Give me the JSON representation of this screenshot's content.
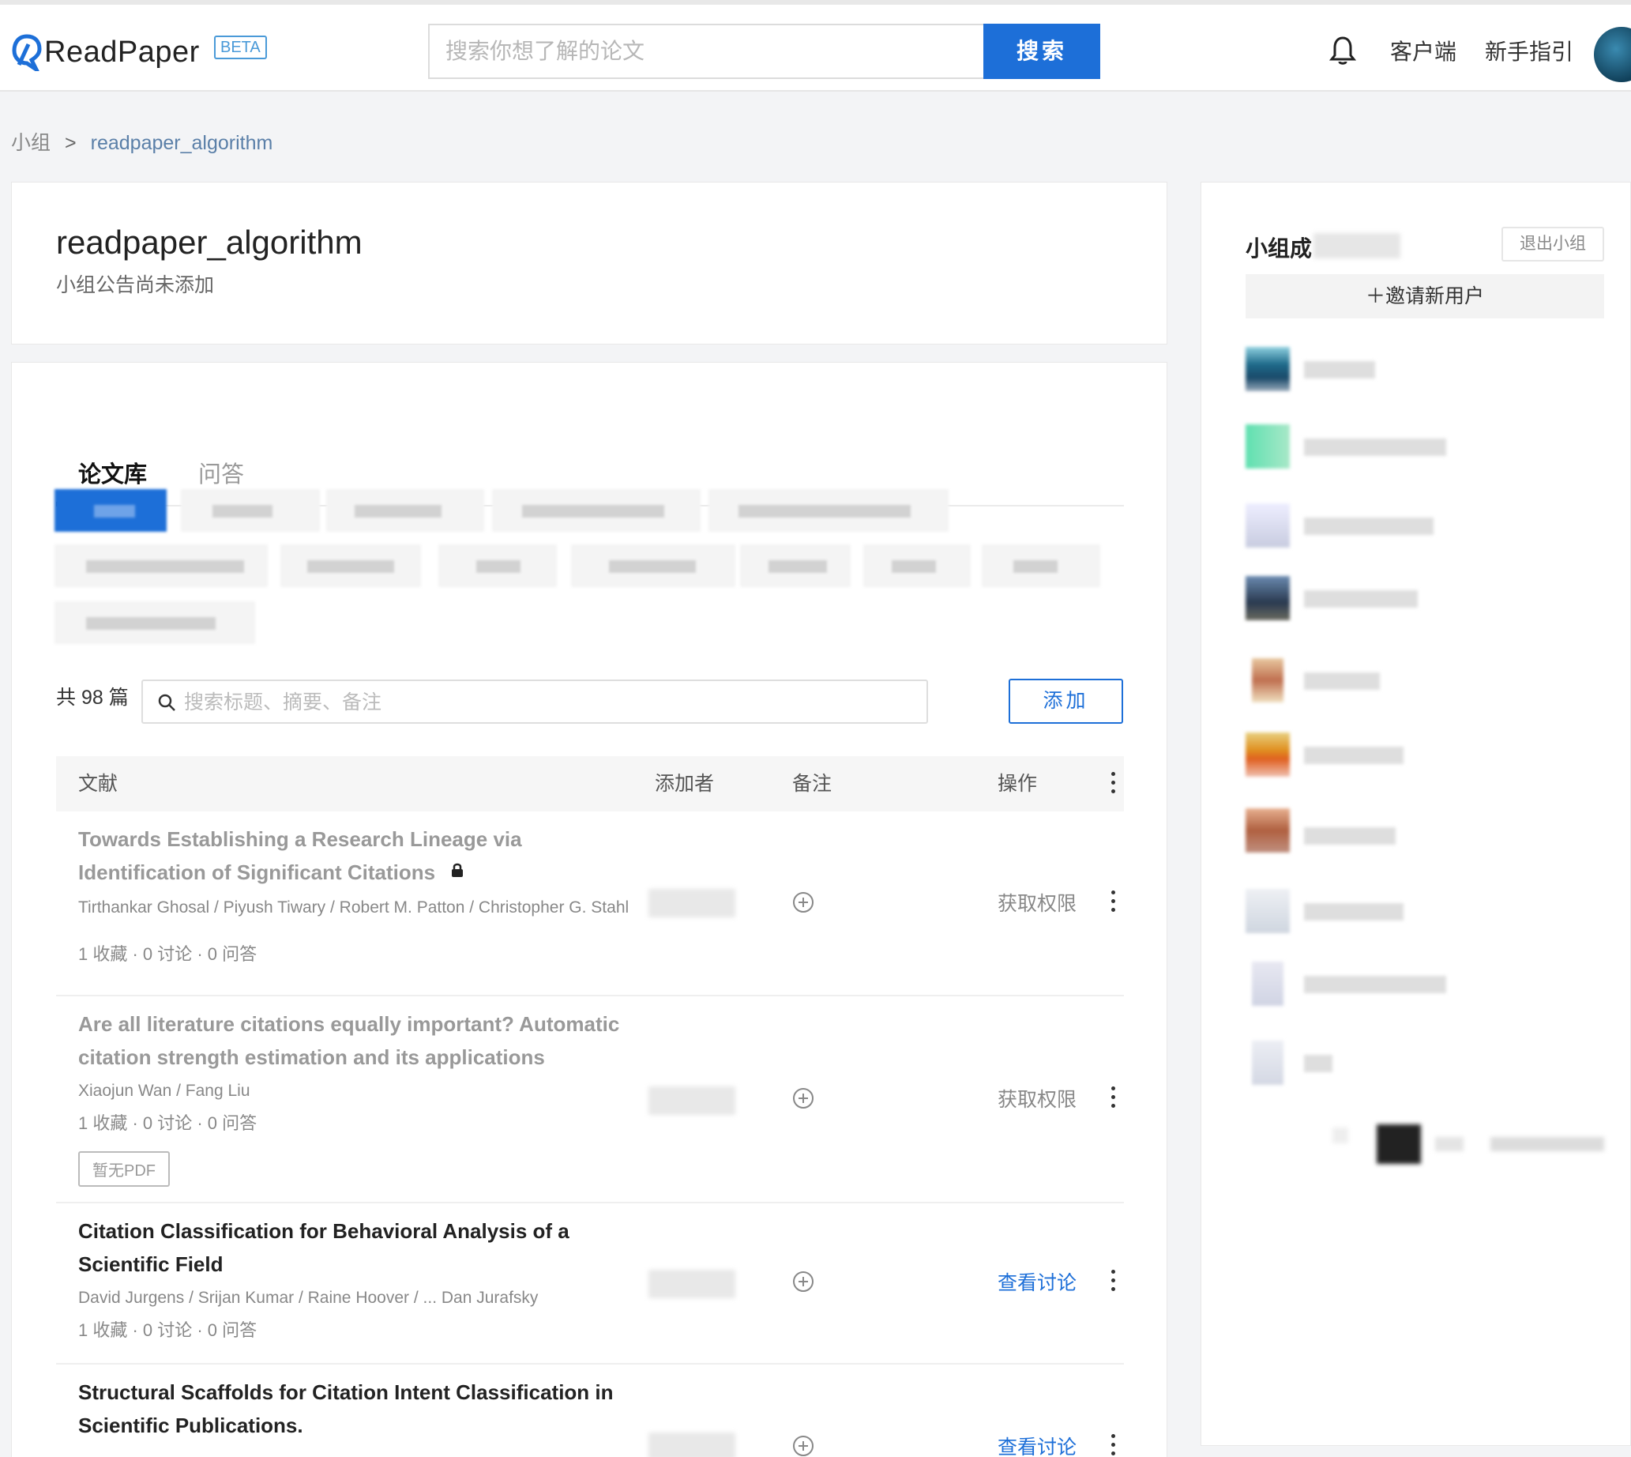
{
  "header": {
    "logo_text": "ReadPaper",
    "beta": "BETA",
    "search_placeholder": "搜索你想了解的论文",
    "search_button": "搜索",
    "client_link": "客户端",
    "guide_link": "新手指引"
  },
  "breadcrumb": {
    "root": "小组",
    "current": "readpaper_algorithm"
  },
  "group": {
    "title": "readpaper_algorithm",
    "notice": "小组公告尚未添加"
  },
  "tabs": [
    "论文库",
    "问答"
  ],
  "library": {
    "count_label": "共 98 篇",
    "search_placeholder": "搜索标题、摘要、备注",
    "add_button": "添加",
    "columns": [
      "文献",
      "添加者",
      "备注",
      "操作"
    ]
  },
  "papers": [
    {
      "title": "Towards Establishing a Research Lineage via Identification of Significant Citations",
      "authors": "Tirthankar Ghosal / Piyush Tiwary / Robert M. Patton / Christopher G. Stahl",
      "stats": "1 收藏 · 0 讨论 · 0 问答",
      "action": "获取权限"
    },
    {
      "title": "Are all literature citations equally important? Automatic citation strength estimation and its applications",
      "authors": "Xiaojun Wan / Fang Liu",
      "stats": "1 收藏 · 0 讨论 · 0 问答",
      "badge": "暂无PDF",
      "action": "获取权限"
    },
    {
      "title": "Citation Classification for Behavioral Analysis of a Scientific Field",
      "authors": "David Jurgens / Srijan Kumar / Raine Hoover / ... Dan Jurafsky",
      "stats": "1 收藏 · 0 讨论 · 0 问答",
      "action": "查看讨论"
    },
    {
      "title": "Structural Scaffolds for Citation Intent Classification in Scientific Publications.",
      "action": "查看讨论"
    }
  ],
  "sidebar": {
    "title": "小组成",
    "leave_button": "退出小组",
    "invite_button": "＋邀请新用户"
  },
  "icons": {
    "bell": "bell-icon",
    "search": "search-icon",
    "lock": "lock-icon",
    "plus": "plus-circle-icon",
    "more": "more-vertical-icon"
  },
  "colors": {
    "primary": "#1d6fd8"
  }
}
